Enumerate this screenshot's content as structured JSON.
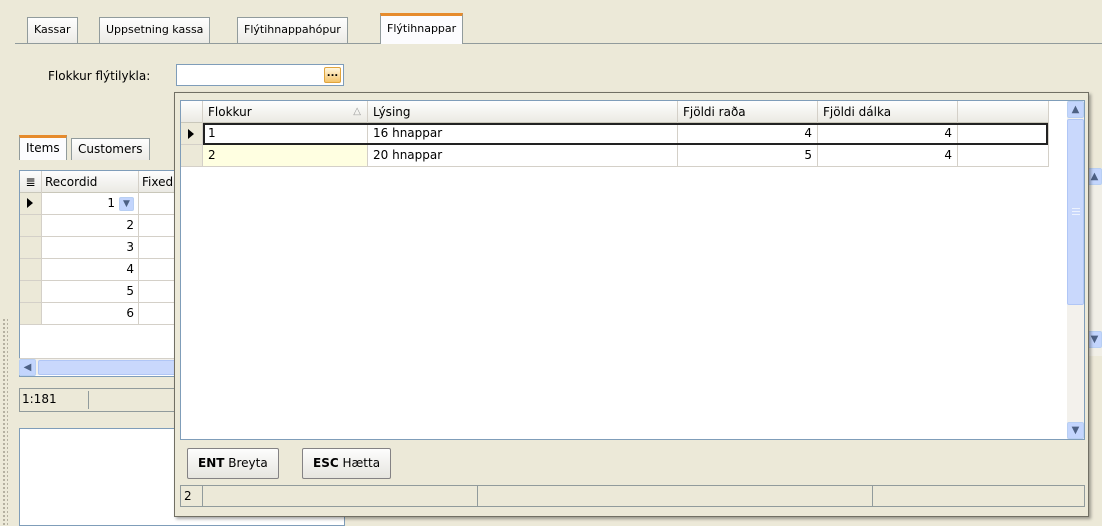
{
  "tabs": [
    "Kassar",
    "Uppsetning kassa",
    "Flýtihnappahópur",
    "Flýtihnappar"
  ],
  "active_tab": "Flýtihnappar",
  "filter": {
    "label": "Flokkur flýtilykla:",
    "value": "",
    "lookup_button": "..."
  },
  "subtabs": [
    "Items",
    "Customers"
  ],
  "items_grid": {
    "columns": [
      "Recordid",
      "Fixed"
    ],
    "rows": [
      "1",
      "2",
      "3",
      "4",
      "5",
      "6"
    ]
  },
  "status_left": "1:181",
  "lookup": {
    "columns": [
      "Flokkur",
      "Lýsing",
      "Fjöldi raða",
      "Fjöldi dálka"
    ],
    "rows": [
      {
        "flokkur": "1",
        "lysing": "16 hnappar",
        "fjoldi_rada": "4",
        "fjoldi_dalka": "4"
      },
      {
        "flokkur": "2",
        "lysing": "20 hnappar",
        "fjoldi_rada": "5",
        "fjoldi_dalka": "4"
      }
    ],
    "buttons": {
      "ok": {
        "key": "ENT",
        "label": "Breyta"
      },
      "cancel": {
        "key": "ESC",
        "label": "Hætta"
      }
    },
    "status_count": "2"
  }
}
